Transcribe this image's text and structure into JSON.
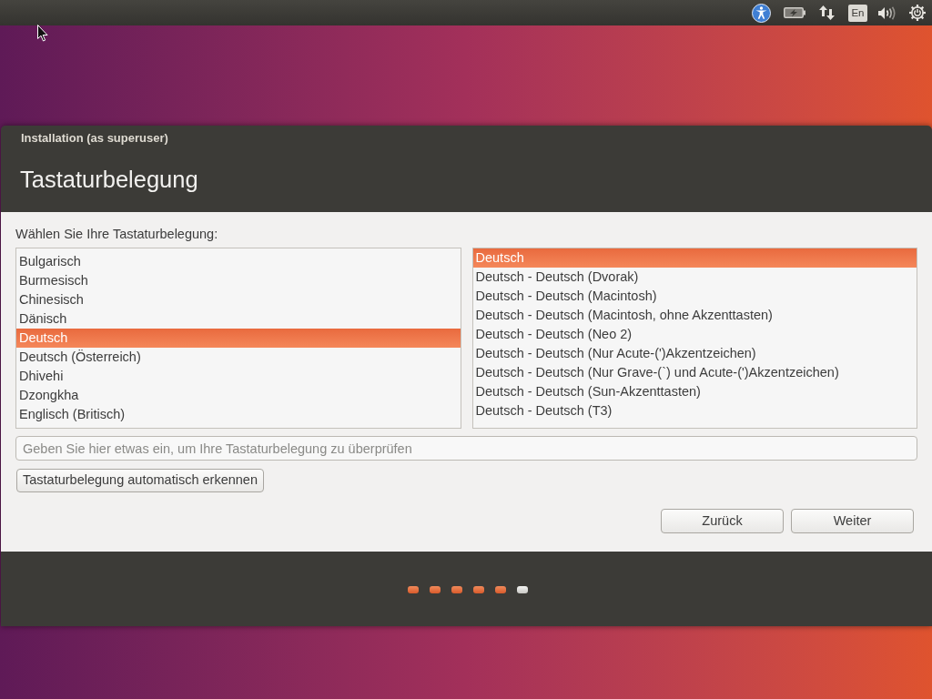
{
  "top_panel": {
    "keyboard_layout": "En"
  },
  "window": {
    "title": "Installation (as superuser)",
    "heading": "Tastaturbelegung"
  },
  "prompt": "Wählen Sie Ihre Tastaturbelegung:",
  "layouts": [
    {
      "label": "Bulgarisch",
      "selected": false
    },
    {
      "label": "Burmesisch",
      "selected": false
    },
    {
      "label": "Chinesisch",
      "selected": false
    },
    {
      "label": "Dänisch",
      "selected": false
    },
    {
      "label": "Deutsch",
      "selected": true
    },
    {
      "label": "Deutsch (Österreich)",
      "selected": false
    },
    {
      "label": "Dhivehi",
      "selected": false
    },
    {
      "label": "Dzongkha",
      "selected": false
    },
    {
      "label": "Englisch (Britisch)",
      "selected": false
    }
  ],
  "variants": [
    {
      "label": "Deutsch",
      "selected": true
    },
    {
      "label": "Deutsch - Deutsch (Dvorak)",
      "selected": false
    },
    {
      "label": "Deutsch - Deutsch (Macintosh)",
      "selected": false
    },
    {
      "label": "Deutsch - Deutsch (Macintosh, ohne Akzenttasten)",
      "selected": false
    },
    {
      "label": "Deutsch - Deutsch (Neo 2)",
      "selected": false
    },
    {
      "label": "Deutsch - Deutsch (Nur Acute-(')Akzentzeichen)",
      "selected": false
    },
    {
      "label": "Deutsch - Deutsch (Nur Grave-(`) und Acute-(')Akzentzeichen)",
      "selected": false
    },
    {
      "label": "Deutsch - Deutsch (Sun-Akzenttasten)",
      "selected": false
    },
    {
      "label": "Deutsch - Deutsch (T3)",
      "selected": false
    }
  ],
  "test_field": {
    "placeholder": "Geben Sie hier etwas ein, um Ihre Tastaturbelegung zu überprüfen"
  },
  "detect_button": "Tastaturbelegung automatisch erkennen",
  "buttons": [
    {
      "label": "Zurück"
    },
    {
      "label": "Weiter"
    }
  ],
  "progress_steps": [
    {
      "done": true
    },
    {
      "done": true
    },
    {
      "done": true
    },
    {
      "done": true
    },
    {
      "done": true
    },
    {
      "done": false
    }
  ]
}
